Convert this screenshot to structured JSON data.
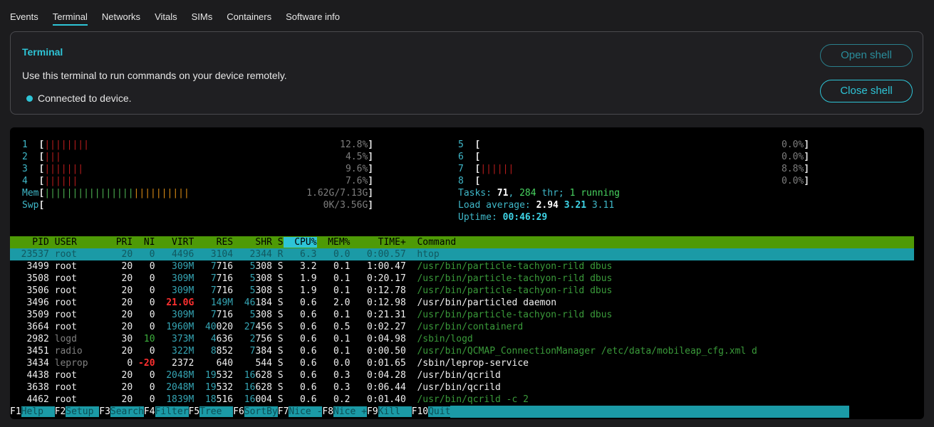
{
  "tabs": [
    "Events",
    "Terminal",
    "Networks",
    "Vitals",
    "SIMs",
    "Containers",
    "Software info"
  ],
  "card": {
    "title": "Terminal",
    "description": "Use this terminal to run commands on your device remotely.",
    "status": "Connected to device.",
    "open_shell": "Open shell",
    "close_shell": "Close shell"
  },
  "htop": {
    "cpus": [
      {
        "id": "1",
        "bars": "||||||||",
        "value": "12.8%"
      },
      {
        "id": "2",
        "bars": "|||",
        "value": "4.5%"
      },
      {
        "id": "3",
        "bars": "|||||||",
        "value": "9.6%"
      },
      {
        "id": "4",
        "bars": "||||||",
        "value": "7.6%"
      },
      {
        "id": "5",
        "bars": "",
        "value": "0.0%"
      },
      {
        "id": "6",
        "bars": "",
        "value": "0.0%"
      },
      {
        "id": "7",
        "bars": "||||||",
        "value": "8.8%"
      },
      {
        "id": "8",
        "bars": "",
        "value": "0.0%"
      }
    ],
    "mem": {
      "label": "Mem",
      "bars_green": "||||||||||||||||",
      "bars_orange": "||||||||||",
      "value": "1.62G/7.13G"
    },
    "swp": {
      "label": "Swp",
      "value": "0K/3.56G"
    },
    "tasks": {
      "label": "Tasks:",
      "count": "71",
      "sep1": ",",
      "thr": "284",
      "thr_label": "thr;",
      "running": "1",
      "running_label": "running"
    },
    "load": {
      "label": "Load average:",
      "l1": "2.94",
      "l5": "3.21",
      "l15": "3.11"
    },
    "uptime": {
      "label": "Uptime:",
      "value": "00:46:29"
    },
    "columns": [
      "PID",
      "USER",
      "PRI",
      "NI",
      "VIRT",
      "RES",
      "SHR",
      "S",
      "CPU%",
      "MEM%",
      "TIME+",
      "Command"
    ],
    "processes": [
      {
        "pid": "23537",
        "user": "root",
        "pri": "20",
        "ni": "0",
        "virt": "4496",
        "res": "3104",
        "shr": "2344",
        "s": "R",
        "cpu": "6.3",
        "mem": "0.0",
        "time": "0:00.57",
        "cmd": "htop"
      },
      {
        "pid": "3499",
        "user": "root",
        "pri": "20",
        "ni": "0",
        "virt": "309M",
        "res": "7716",
        "shr": "5308",
        "s": "S",
        "cpu": "3.2",
        "mem": "0.1",
        "time": "1:00.47",
        "cmd": "/usr/bin/particle-tachyon-rild dbus"
      },
      {
        "pid": "3508",
        "user": "root",
        "pri": "20",
        "ni": "0",
        "virt": "309M",
        "res": "7716",
        "shr": "5308",
        "s": "S",
        "cpu": "1.9",
        "mem": "0.1",
        "time": "0:20.17",
        "cmd": "/usr/bin/particle-tachyon-rild dbus"
      },
      {
        "pid": "3506",
        "user": "root",
        "pri": "20",
        "ni": "0",
        "virt": "309M",
        "res": "7716",
        "shr": "5308",
        "s": "S",
        "cpu": "1.9",
        "mem": "0.1",
        "time": "0:12.78",
        "cmd": "/usr/bin/particle-tachyon-rild dbus"
      },
      {
        "pid": "3496",
        "user": "root",
        "pri": "20",
        "ni": "0",
        "virt": "21.0G",
        "res": "149M",
        "shr": "46184",
        "s": "S",
        "cpu": "0.6",
        "mem": "2.0",
        "time": "0:12.98",
        "cmd": "/usr/bin/particled daemon"
      },
      {
        "pid": "3509",
        "user": "root",
        "pri": "20",
        "ni": "0",
        "virt": "309M",
        "res": "7716",
        "shr": "5308",
        "s": "S",
        "cpu": "0.6",
        "mem": "0.1",
        "time": "0:21.31",
        "cmd": "/usr/bin/particle-tachyon-rild dbus"
      },
      {
        "pid": "3664",
        "user": "root",
        "pri": "20",
        "ni": "0",
        "virt": "1960M",
        "res": "40020",
        "shr": "27456",
        "s": "S",
        "cpu": "0.6",
        "mem": "0.5",
        "time": "0:02.27",
        "cmd": "/usr/bin/containerd"
      },
      {
        "pid": "2982",
        "user": "logd",
        "pri": "30",
        "ni": "10",
        "virt": "373M",
        "res": "4636",
        "shr": "2756",
        "s": "S",
        "cpu": "0.6",
        "mem": "0.1",
        "time": "0:04.98",
        "cmd": "/sbin/logd"
      },
      {
        "pid": "3451",
        "user": "radio",
        "pri": "20",
        "ni": "0",
        "virt": "322M",
        "res": "8852",
        "shr": "7384",
        "s": "S",
        "cpu": "0.6",
        "mem": "0.1",
        "time": "0:00.50",
        "cmd": "/usr/bin/QCMAP_ConnectionManager /etc/data/mobileap_cfg.xml d"
      },
      {
        "pid": "3434",
        "user": "leprop",
        "pri": "0",
        "ni": "-20",
        "virt": "2372",
        "res": "640",
        "shr": "544",
        "s": "S",
        "cpu": "0.6",
        "mem": "0.0",
        "time": "0:01.65",
        "cmd": "/sbin/leprop-service"
      },
      {
        "pid": "4438",
        "user": "root",
        "pri": "20",
        "ni": "0",
        "virt": "2048M",
        "res": "19532",
        "shr": "16628",
        "s": "S",
        "cpu": "0.6",
        "mem": "0.3",
        "time": "0:04.28",
        "cmd": "/usr/bin/qcrild"
      },
      {
        "pid": "3638",
        "user": "root",
        "pri": "20",
        "ni": "0",
        "virt": "2048M",
        "res": "19532",
        "shr": "16628",
        "s": "S",
        "cpu": "0.6",
        "mem": "0.3",
        "time": "0:06.44",
        "cmd": "/usr/bin/qcrild"
      },
      {
        "pid": "4462",
        "user": "root",
        "pri": "20",
        "ni": "0",
        "virt": "1839M",
        "res": "18516",
        "shr": "16004",
        "s": "S",
        "cpu": "0.6",
        "mem": "0.2",
        "time": "0:01.40",
        "cmd": "/usr/bin/qcrild -c 2"
      }
    ],
    "fkeys": [
      {
        "key": "F1",
        "label": "Help  "
      },
      {
        "key": "F2",
        "label": "Setup "
      },
      {
        "key": "F3",
        "label": "Search"
      },
      {
        "key": "F4",
        "label": "Filter"
      },
      {
        "key": "F5",
        "label": "Tree  "
      },
      {
        "key": "F6",
        "label": "SortBy"
      },
      {
        "key": "F7",
        "label": "Nice -"
      },
      {
        "key": "F8",
        "label": "Nice +"
      },
      {
        "key": "F9",
        "label": "Kill  "
      },
      {
        "key": "F10",
        "label": "Quit"
      }
    ],
    "colors": {
      "accent": "#2ec4d6",
      "header_bg": "#4e9a06",
      "selected_bg": "#1b9aa6",
      "terminal_bg": "#000000"
    }
  }
}
